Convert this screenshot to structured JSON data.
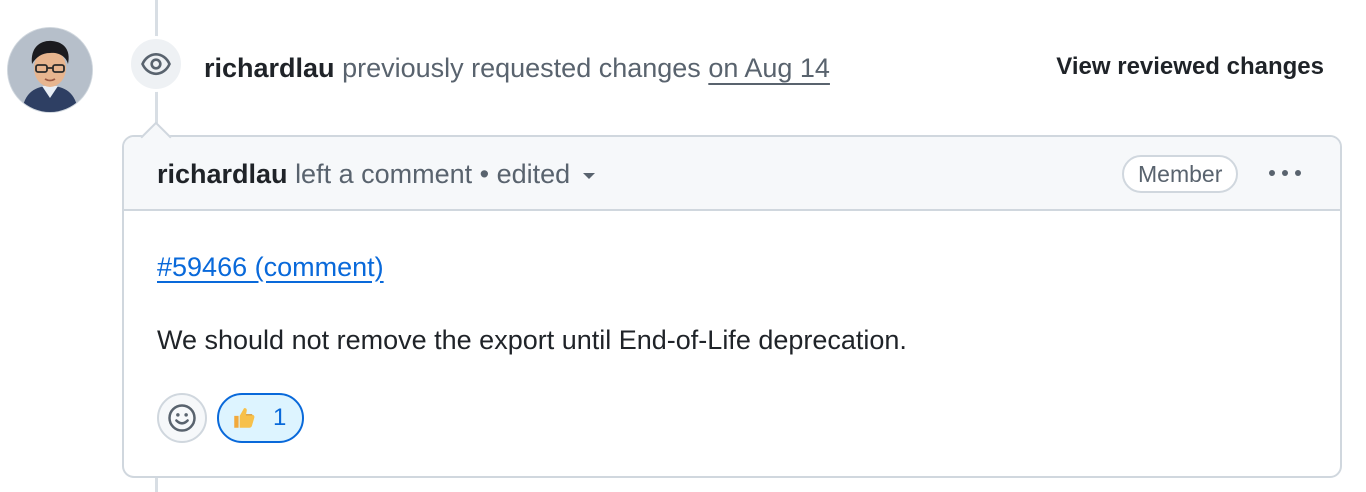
{
  "event": {
    "author": "richardlau",
    "action": "previously requested changes",
    "date_link": "on Aug 14",
    "view_link": "View reviewed changes"
  },
  "comment": {
    "author": "richardlau",
    "action": "left a comment",
    "separator": "•",
    "edited": "edited",
    "badge": "Member",
    "reference_link": "#59466 (comment)",
    "body": "We should not remove the export until End-of-Life deprecation."
  },
  "reactions": [
    {
      "emoji": "thumbs-up",
      "count": "1"
    }
  ],
  "colors": {
    "link": "#0969da",
    "muted": "#59636e",
    "border": "#d0d7de",
    "header_bg": "#f6f8fa",
    "reaction_bg": "#ddf4ff"
  }
}
